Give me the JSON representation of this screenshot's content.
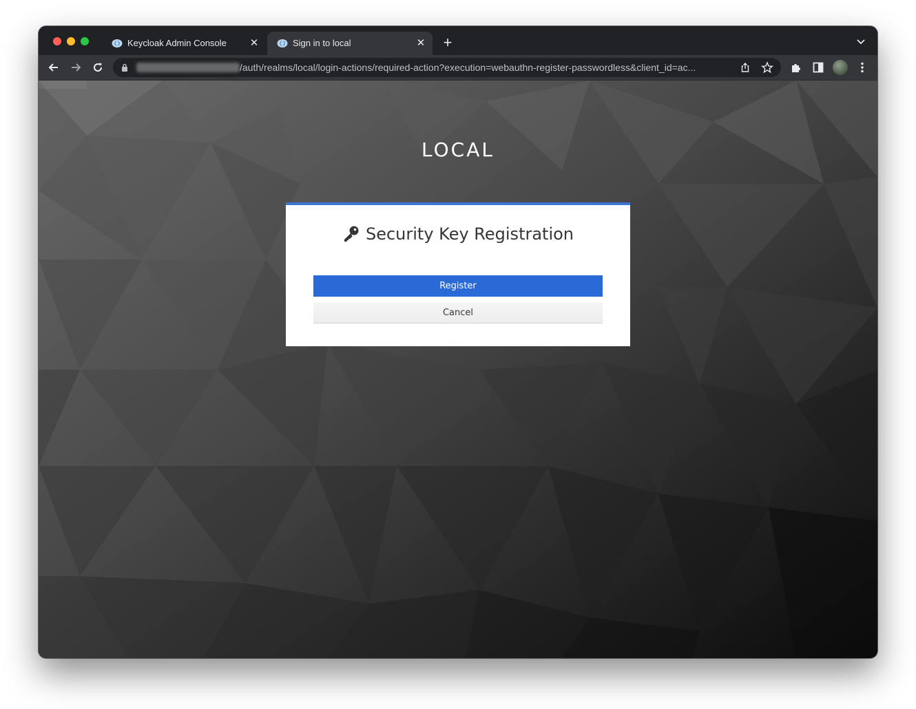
{
  "browser": {
    "tabs": [
      {
        "title": "Keycloak Admin Console",
        "active": false
      },
      {
        "title": "Sign in to local",
        "active": true
      }
    ],
    "new_tab_label": "+",
    "close_glyph": "✕",
    "url_path": "/auth/realms/local/login-actions/required-action?execution=webauthn-register-passwordless&client_id=ac..."
  },
  "page": {
    "realm_title": "LOCAL",
    "card_heading": "Security Key Registration",
    "register_label": "Register",
    "cancel_label": "Cancel"
  },
  "colors": {
    "accent": "#2a6ad6",
    "card_top_border": "#3a76d8",
    "browser_chrome": "#202124"
  }
}
